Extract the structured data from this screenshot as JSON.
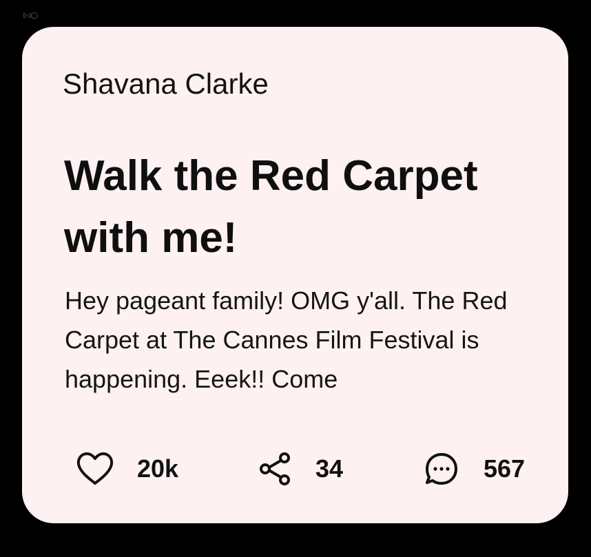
{
  "corner_mark": "▯◁◯",
  "card": {
    "author": "Shavana Clarke",
    "title": "Walk the Red Carpet with me!",
    "excerpt": "Hey pageant family! OMG y'all. The Red Carpet at The Cannes Film Festival is happening. Eeek!! Come"
  },
  "actions": {
    "likes": {
      "icon": "heart-icon",
      "count": "20k"
    },
    "shares": {
      "icon": "share-icon",
      "count": "34"
    },
    "comments": {
      "icon": "comment-icon",
      "count": "567"
    }
  },
  "colors": {
    "background": "#000000",
    "card": "#fdf1f1",
    "text": "#111111"
  }
}
